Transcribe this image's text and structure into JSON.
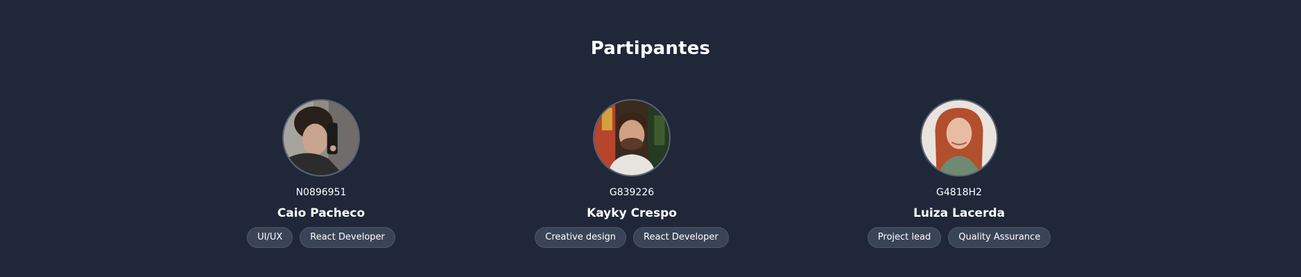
{
  "section": {
    "title": "Partipantes"
  },
  "participants": [
    {
      "id": "N0896951",
      "name": "Caio Pacheco",
      "tags": [
        "UI/UX",
        "React Developer"
      ],
      "avatar_icon": "person-photo-icon"
    },
    {
      "id": "G839226",
      "name": "Kayky Crespo",
      "tags": [
        "Creative design",
        "React Developer"
      ],
      "avatar_icon": "person-photo-icon"
    },
    {
      "id": "G4818H2",
      "name": "Luiza Lacerda",
      "tags": [
        "Project lead",
        "Quality Assurance"
      ],
      "avatar_icon": "person-photo-icon"
    }
  ],
  "colors": {
    "background": "#1f2739",
    "tag_background": "#3a4457",
    "tag_border": "#4e586c",
    "text": "#ffffff"
  }
}
